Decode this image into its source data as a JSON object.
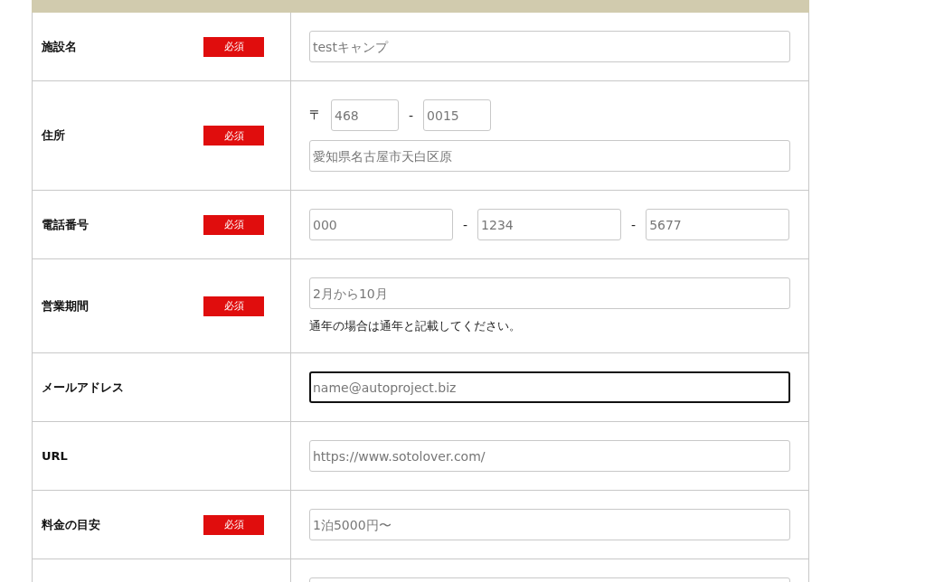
{
  "rows": [
    {
      "kind": "text",
      "label": "施設名",
      "badge": "必須",
      "fields": [
        {
          "placeholder": "testキャンプ",
          "focused": false
        }
      ]
    },
    {
      "kind": "address",
      "label": "住所",
      "badge": "必須",
      "postal_mark": "〒",
      "separator": "-",
      "postal": [
        {
          "placeholder": "468",
          "focused": false
        },
        {
          "placeholder": "0015",
          "focused": false
        }
      ],
      "fields": [
        {
          "placeholder": "愛知県名古屋市天白区原",
          "focused": false
        }
      ]
    },
    {
      "kind": "phone",
      "label": "電話番号",
      "badge": "必須",
      "separator": "-",
      "fields": [
        {
          "placeholder": "000",
          "focused": false
        },
        {
          "placeholder": "1234",
          "focused": false
        },
        {
          "placeholder": "5677",
          "focused": false
        }
      ]
    },
    {
      "kind": "text",
      "label": "営業期間",
      "badge": "必須",
      "fields": [
        {
          "placeholder": "2月から10月",
          "focused": false
        }
      ],
      "note": "通年の場合は通年と記載してください。"
    },
    {
      "kind": "text",
      "label": "メールアドレス",
      "fields": [
        {
          "placeholder": "name@autoproject.biz",
          "focused": true
        }
      ]
    },
    {
      "kind": "text",
      "label": "URL",
      "fields": [
        {
          "placeholder": "https://www.sotolover.com/",
          "focused": false
        }
      ]
    },
    {
      "kind": "text",
      "label": "料金の目安",
      "badge": "必須",
      "fields": [
        {
          "placeholder": "1泊5000円〜",
          "focused": false
        }
      ]
    },
    {
      "kind": "text",
      "fields": [
        {
          "focused": false
        }
      ]
    }
  ]
}
